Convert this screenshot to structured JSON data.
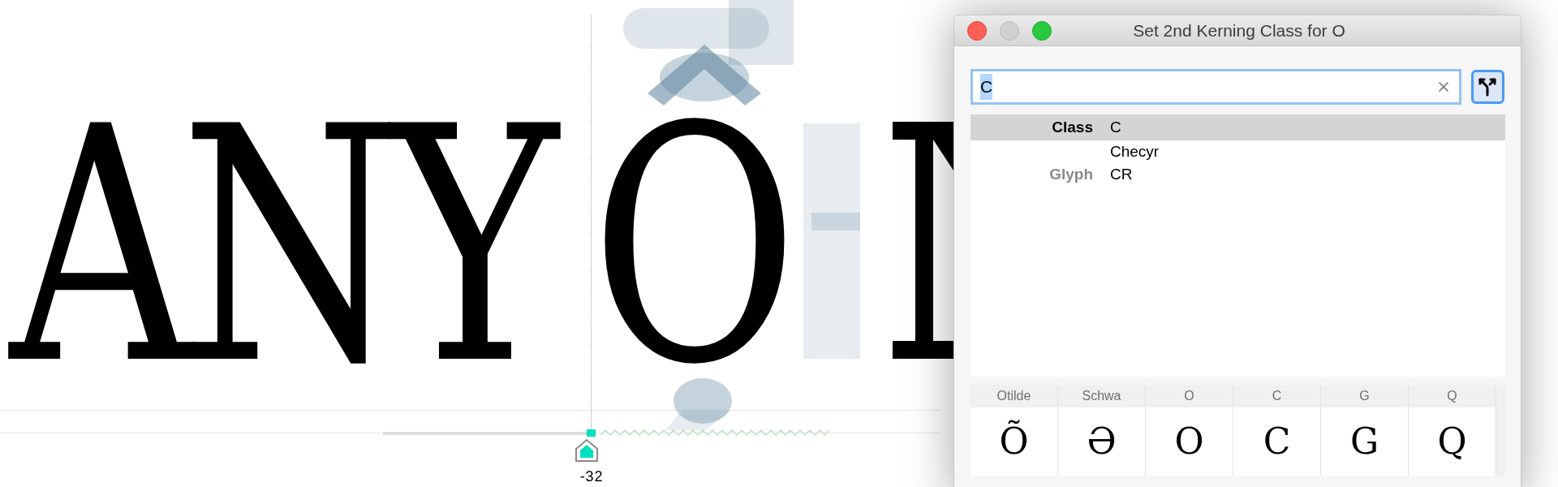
{
  "canvas": {
    "glyphs": [
      "A",
      "N",
      "Y",
      "O"
    ],
    "kerning_value": "-32"
  },
  "dialog": {
    "title": "Set 2nd Kerning Class for O",
    "minimize_enabled": false,
    "search": {
      "value": "C",
      "text_selected": true
    },
    "results": [
      {
        "label": "Class",
        "value": "C",
        "selected": true
      },
      {
        "value": "Checyr",
        "selected": false
      },
      {
        "label": "Glyph",
        "value": "CR",
        "selected": false
      }
    ],
    "glyph_grid": [
      {
        "name": "Otilde",
        "glyph": "Õ"
      },
      {
        "name": "Schwa",
        "glyph": "Ə"
      },
      {
        "name": "O",
        "glyph": "O"
      },
      {
        "name": "C",
        "glyph": "C"
      },
      {
        "name": "G",
        "glyph": "G"
      },
      {
        "name": "Q",
        "glyph": "Q"
      }
    ]
  }
}
